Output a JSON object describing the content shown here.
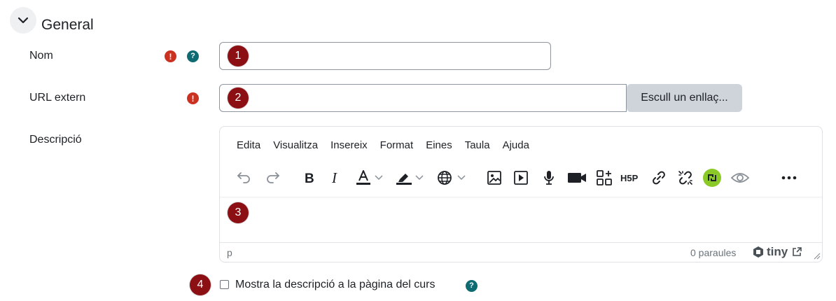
{
  "section": {
    "title": "General",
    "toggle_icon": "chevron-down-icon"
  },
  "fields": {
    "name": {
      "label": "Nom",
      "value": "",
      "badge": "1"
    },
    "url": {
      "label": "URL extern",
      "value": "",
      "badge": "2",
      "choose_link": "Escull un enllaç..."
    },
    "description": {
      "label": "Descripció",
      "badge": "3"
    }
  },
  "editor": {
    "menu": [
      "Edita",
      "Visualitza",
      "Insereix",
      "Format",
      "Eines",
      "Taula",
      "Ajuda"
    ],
    "status_path": "p",
    "word_count": "0 paraules",
    "brand": "tiny"
  },
  "show_description": {
    "label": "Mostra la descripció a la pàgina del curs",
    "badge": "4",
    "checked": false
  },
  "icons": {
    "required": "!",
    "help": "?"
  },
  "colors": {
    "required": "#ca3120",
    "help": "#0f6b72",
    "badge": "#8b0f13",
    "h5p_highlight": "#8ac926"
  }
}
